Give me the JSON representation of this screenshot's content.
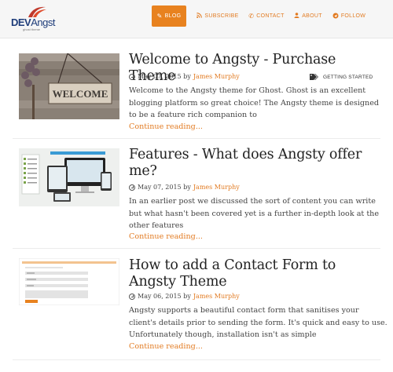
{
  "logo": {
    "dev": "DEV",
    "angst": "Angst",
    "tagline": "ghost theme"
  },
  "nav": [
    {
      "label": "Blog",
      "icon": "pencil-icon"
    },
    {
      "label": "Subscribe",
      "icon": "rss-icon"
    },
    {
      "label": "Contact",
      "icon": "phone-icon"
    },
    {
      "label": "About",
      "icon": "user-icon"
    },
    {
      "label": "Follow",
      "icon": "share-icon"
    }
  ],
  "posts": [
    {
      "title": "Welcome to Angsty - Purchase Theme",
      "date": "May 07, 2015",
      "by": "by",
      "author": "James Murphy",
      "tag": "GETTING STARTED",
      "excerpt": "Welcome to the Angsty theme for Ghost. Ghost is an excellent blogging platform so great choice! The Angsty theme is designed to be a feature rich companion to",
      "more": "Continue reading...",
      "thumb_text": "WELCOME"
    },
    {
      "title": "Features - What does Angsty offer me?",
      "date": "May 07, 2015",
      "by": "by",
      "author": "James Murphy",
      "excerpt": "In an earlier post we discussed the sort of content you can write but what hasn't been covered yet is a further in-depth look at the other features",
      "more": "Continue reading..."
    },
    {
      "title": "How to add a Contact Form to Angsty Theme",
      "date": "May 06, 2015",
      "by": "by",
      "author": "James Murphy",
      "excerpt": "Angsty supports a beautiful contact form that sanitises your client's details prior to sending the form. It's quick and easy to use. Unfortunately though, installation isn't as simple",
      "more": "Continue reading..."
    }
  ],
  "colors": {
    "accent": "#e8821f",
    "link": "#e27b22",
    "header_bg": "#f6f6f6"
  }
}
